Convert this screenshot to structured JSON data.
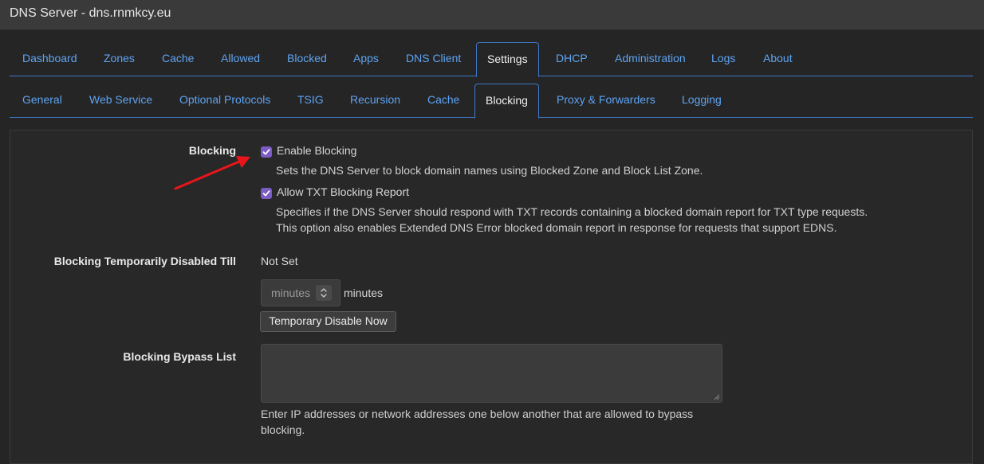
{
  "window": {
    "title": "DNS Server - dns.rnmkcy.eu"
  },
  "main_tabs": [
    {
      "label": "Dashboard"
    },
    {
      "label": "Zones"
    },
    {
      "label": "Cache"
    },
    {
      "label": "Allowed"
    },
    {
      "label": "Blocked"
    },
    {
      "label": "Apps"
    },
    {
      "label": "DNS Client"
    },
    {
      "label": "Settings"
    },
    {
      "label": "DHCP"
    },
    {
      "label": "Administration"
    },
    {
      "label": "Logs"
    },
    {
      "label": "About"
    }
  ],
  "main_active": "Settings",
  "sub_tabs": [
    {
      "label": "General"
    },
    {
      "label": "Web Service"
    },
    {
      "label": "Optional Protocols"
    },
    {
      "label": "TSIG"
    },
    {
      "label": "Recursion"
    },
    {
      "label": "Cache"
    },
    {
      "label": "Blocking"
    },
    {
      "label": "Proxy & Forwarders"
    },
    {
      "label": "Logging"
    }
  ],
  "sub_active": "Blocking",
  "blocking": {
    "label": "Blocking",
    "enable": {
      "label": "Enable Blocking",
      "checked": true,
      "help": "Sets the DNS Server to block domain names using Blocked Zone and Block List Zone."
    },
    "txt_report": {
      "label": "Allow TXT Blocking Report",
      "checked": true,
      "help_line1": "Specifies if the DNS Server should respond with TXT records containing a blocked domain report for TXT type requests.",
      "help_line2": "This option also enables Extended DNS Error blocked domain report in response for requests that support EDNS."
    }
  },
  "temp_disable": {
    "label": "Blocking Temporarily Disabled Till",
    "value": "Not Set",
    "minutes_placeholder": "minutes",
    "minutes_suffix": "minutes",
    "button_label": "Temporary Disable Now"
  },
  "bypass": {
    "label": "Blocking Bypass List",
    "value": "",
    "help_line1": "Enter IP addresses or network addresses one below another that are allowed to bypass",
    "help_line2": "blocking."
  },
  "colors": {
    "accent": "#5ea4f1",
    "checkbox": "#7b5cc4",
    "annotation_arrow": "#e8161b"
  }
}
